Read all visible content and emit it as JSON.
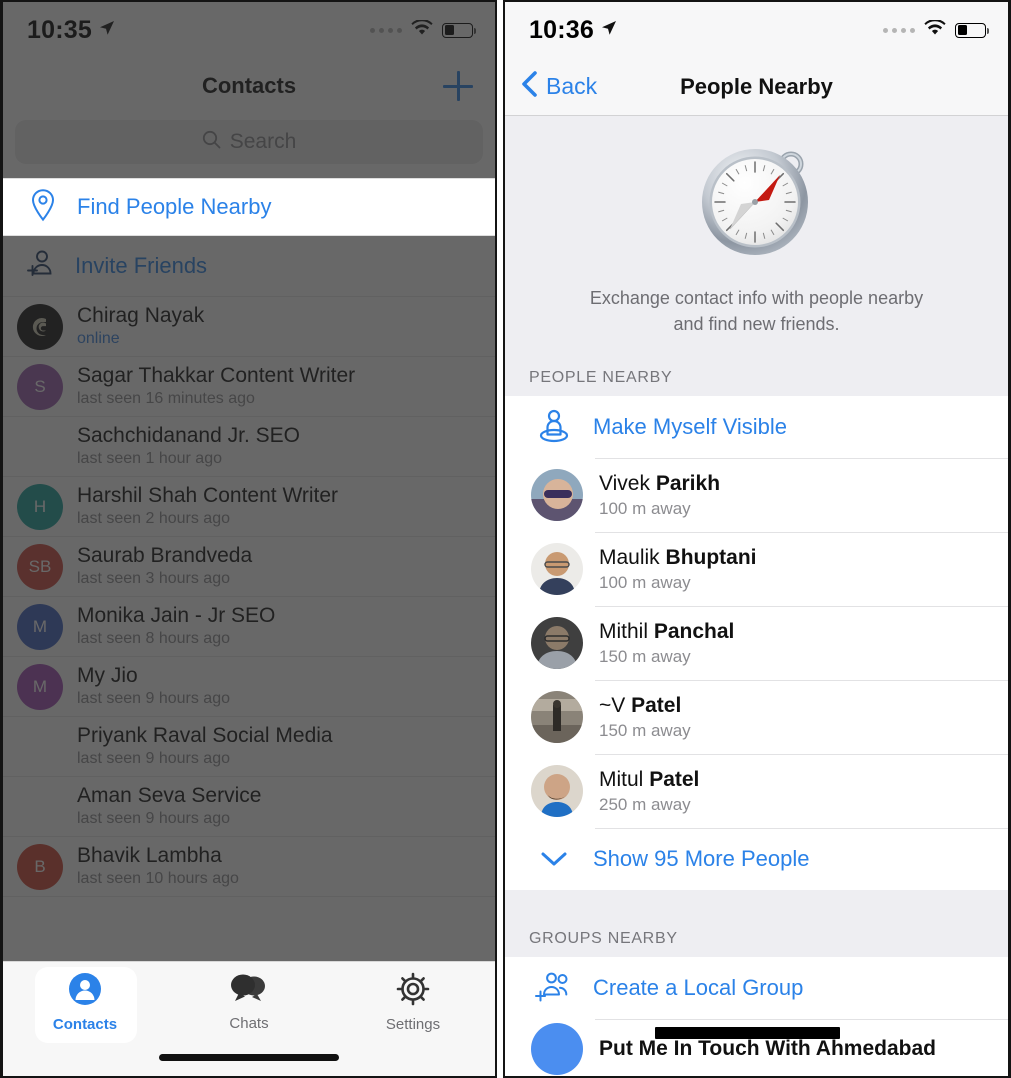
{
  "left_phone": {
    "status_bar": {
      "time": "10:35",
      "location_icon": "location-arrow-icon",
      "wifi_icon": "wifi-icon",
      "battery_icon": "battery-icon"
    },
    "nav": {
      "title": "Contacts",
      "add_button": "+"
    },
    "search": {
      "placeholder": "Search",
      "icon": "search-icon"
    },
    "find_people_nearby": {
      "label": "Find People Nearby",
      "icon": "map-pin-icon"
    },
    "invite_friends": {
      "label": "Invite Friends",
      "icon": "person-add-icon"
    },
    "contacts": [
      {
        "name": "Chirag Nayak",
        "status": "online",
        "online": true,
        "initials": "",
        "color": "#151515",
        "has_photo": true
      },
      {
        "name": "Sagar Thakkar Content Writer",
        "status": "last seen 16 minutes ago",
        "online": false,
        "initials": "S",
        "color": "#9b5cb0",
        "has_photo": false
      },
      {
        "name": "Sachchidanand Jr. SEO",
        "status": "last seen 1 hour ago",
        "online": false,
        "initials": "",
        "color": "transparent",
        "has_photo": false
      },
      {
        "name": "Harshil Shah Content Writer",
        "status": "last seen 2 hours ago",
        "online": false,
        "initials": "H",
        "color": "#18a19a",
        "has_photo": false
      },
      {
        "name": "Saurab Brandveda",
        "status": "last seen 3 hours ago",
        "online": false,
        "initials": "SB",
        "color": "#d1483c",
        "has_photo": false
      },
      {
        "name": "Monika Jain - Jr SEO",
        "status": "last seen 8 hours ago",
        "online": false,
        "initials": "M",
        "color": "#3f62c4",
        "has_photo": false
      },
      {
        "name": "My Jio",
        "status": "last seen 9 hours ago",
        "online": false,
        "initials": "M",
        "color": "#a14cb4",
        "has_photo": false
      },
      {
        "name": "Priyank Raval Social Media",
        "status": "last seen 9 hours ago",
        "online": false,
        "initials": "",
        "color": "transparent",
        "has_photo": false
      },
      {
        "name": "Aman Seva Service",
        "status": "last seen 9 hours ago",
        "online": false,
        "initials": "",
        "color": "transparent",
        "has_photo": false
      },
      {
        "name": "Bhavik Lambha",
        "status": "last seen 10 hours ago",
        "online": false,
        "initials": "B",
        "color": "#cf4535",
        "has_photo": false
      }
    ],
    "tabs": [
      {
        "label": "Contacts",
        "icon": "person-circle-icon",
        "active": true
      },
      {
        "label": "Chats",
        "icon": "chat-bubbles-icon",
        "active": false
      },
      {
        "label": "Settings",
        "icon": "gear-icon",
        "active": false
      }
    ]
  },
  "right_phone": {
    "status_bar": {
      "time": "10:36",
      "location_icon": "location-arrow-icon",
      "wifi_icon": "wifi-icon",
      "battery_icon": "battery-icon"
    },
    "nav": {
      "back_label": "Back",
      "title": "People Nearby",
      "back_icon": "chevron-left-icon"
    },
    "hero": {
      "icon": "compass-icon",
      "description_line1": "Exchange contact info with people nearby",
      "description_line2": "and find new friends."
    },
    "people_section": {
      "header": "PEOPLE NEARBY",
      "make_visible": {
        "label": "Make Myself Visible",
        "icon": "person-location-icon"
      },
      "people": [
        {
          "first_name": "Vivek",
          "last_name": "Parikh",
          "distance": "100 m away",
          "avatar_colors": [
            "#6a5f8e",
            "#c6a58a"
          ]
        },
        {
          "first_name": "Maulik",
          "last_name": "Bhuptani",
          "distance": "100 m away",
          "avatar_colors": [
            "#e9e5e0",
            "#3b4358"
          ]
        },
        {
          "first_name": "Mithil",
          "last_name": "Panchal",
          "distance": "150 m away",
          "avatar_colors": [
            "#4a4a4a",
            "#8e9099"
          ]
        },
        {
          "first_name": "~V",
          "last_name": "Patel",
          "distance": "150 m away",
          "avatar_colors": [
            "#7b766e",
            "#3d3a36"
          ]
        },
        {
          "first_name": "Mitul",
          "last_name": "Patel",
          "distance": "250 m away",
          "avatar_colors": [
            "#d6b79a",
            "#1f6fc4"
          ]
        }
      ],
      "show_more": {
        "label": "Show 95 More People",
        "icon": "chevron-down-icon"
      }
    },
    "groups_section": {
      "header": "GROUPS NEARBY",
      "create_group": {
        "label": "Create a Local Group",
        "icon": "group-add-icon"
      },
      "groups": [
        {
          "name": "Put Me In Touch With Ahmedabad",
          "avatar_color": "#4b8ef0"
        }
      ]
    }
  },
  "colors": {
    "accent_blue": "#2b82e8",
    "panel_gray": "#eeeef2",
    "sub_gray": "#8c8c90",
    "dim_overlay": "rgba(40,40,40,0.70)"
  }
}
